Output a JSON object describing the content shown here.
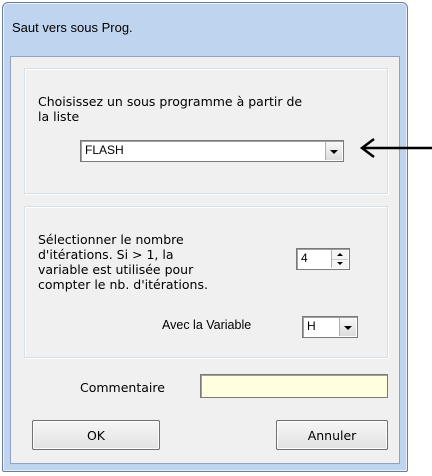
{
  "window": {
    "title": "Saut vers sous Prog."
  },
  "subprogram_group": {
    "instruction": "Choisissez un sous programme à partir de\nla liste",
    "selected": "FLASH"
  },
  "iteration_group": {
    "instruction": "Sélectionner le nombre\nd'itérations. Si > 1, la\nvariable est utilisée pour\ncompter le nb. d'itérations.",
    "count_value": "4",
    "variable_label": "Avec la Variable",
    "variable_value": "H"
  },
  "comment": {
    "label": "Commentaire",
    "value": ""
  },
  "buttons": {
    "ok": "OK",
    "cancel": "Annuler"
  }
}
